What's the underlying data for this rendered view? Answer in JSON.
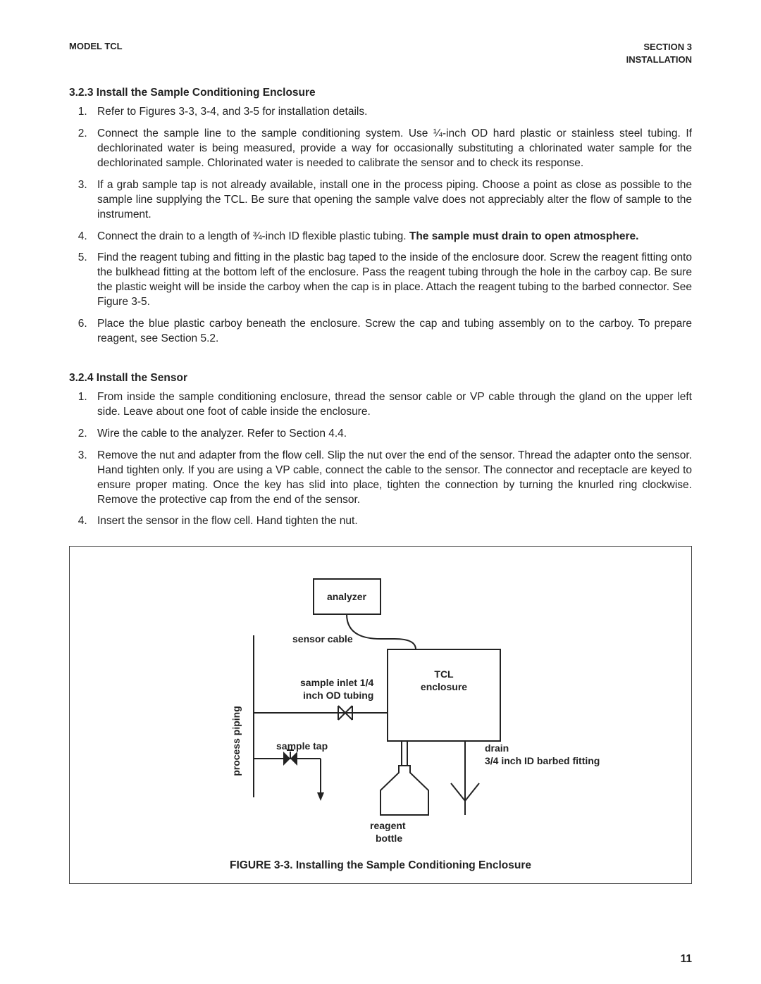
{
  "header": {
    "left": "MODEL TCL",
    "right_line1": "SECTION 3",
    "right_line2": "INSTALLATION"
  },
  "section_323": {
    "title": "3.2.3 Install the Sample Conditioning Enclosure",
    "items": [
      "Refer to Figures 3-3, 3-4, and 3-5 for installation details.",
      "Connect the sample line to the sample conditioning system. Use ¼-inch OD hard plastic or stainless steel tubing. If dechlorinated water is being measured, provide a way for occasionally substituting a chlorinated water sample for the dechlorinated sample. Chlorinated water is needed to calibrate the sensor and to check its response.",
      "If a grab sample tap is not already available, install one in the process piping. Choose a point as close as possible to the sample line supplying the TCL. Be sure that opening the sample valve does not appreciably alter the flow of sample to the instrument.",
      "",
      "Find the reagent tubing and fitting in the plastic bag taped to the inside of the enclosure door. Screw the reagent fitting onto the bulkhead fitting at the bottom left of the enclosure. Pass the reagent tubing through the hole in the carboy cap. Be sure the plastic weight will be inside the carboy when the cap is in place. Attach the reagent tubing to the barbed connector. See Figure 3-5.",
      "Place the blue plastic carboy beneath the enclosure. Screw the cap and tubing assembly on to the carboy. To prepare reagent, see Section 5.2."
    ],
    "item4_prefix": "Connect the drain to a length of ¾-inch ID flexible plastic tubing. ",
    "item4_bold": "The sample must drain to open atmosphere."
  },
  "section_324": {
    "title": "3.2.4 Install the Sensor",
    "items": [
      "From inside the sample conditioning enclosure, thread the sensor cable or VP cable through the gland on the upper left side. Leave about one foot of cable inside the enclosure.",
      "Wire the cable to the analyzer. Refer to Section 4.4.",
      "Remove the nut and adapter from the flow cell. Slip the nut over the end of the sensor. Thread the adapter onto the sensor. Hand tighten only. If you are using a VP cable, connect the cable to the sensor. The connector and receptacle are keyed to ensure proper mating. Once the key has slid into place, tighten the connection by turning the knurled ring clockwise. Remove the protective cap from the end of the sensor.",
      "Insert the sensor in the flow cell. Hand tighten the nut."
    ]
  },
  "diagram": {
    "analyzer": "analyzer",
    "sensor_cable": "sensor cable",
    "sample_inlet_l1": "sample inlet 1/4",
    "sample_inlet_l2": "inch OD tubing",
    "tcl_l1": "TCL",
    "tcl_l2": "enclosure",
    "process_piping": "process piping",
    "sample_tap": "sample tap",
    "drain_l1": "drain",
    "drain_l2": "3/4 inch ID barbed fitting",
    "reagent_l1": "reagent",
    "reagent_l2": "bottle"
  },
  "figure_caption": "FIGURE 3-3. Installing the Sample Conditioning Enclosure",
  "page_number": "11"
}
